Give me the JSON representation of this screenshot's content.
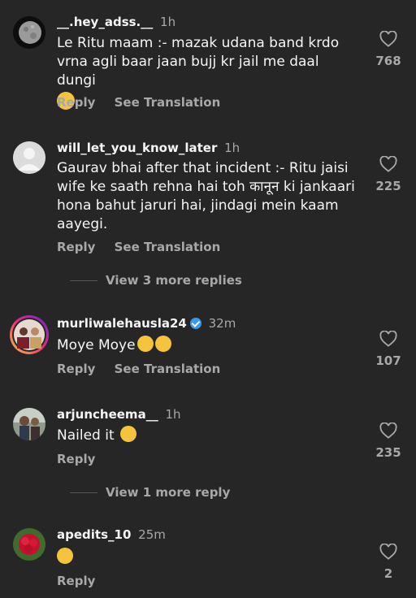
{
  "comments": [
    {
      "username": "__.hey_adss.__",
      "time": "1h",
      "text": "Le Ritu maam :- mazak udana band krdo vrna agli baar jaan bujj kr jail me daal dungi",
      "emojis": [
        "hugging-face"
      ],
      "likes": "768",
      "reply": "Reply",
      "translate": "See Translation",
      "avatar": "moon-avatar"
    },
    {
      "username": "will_let_you_know_later",
      "time": "1h",
      "text": "Gaurav bhai after that incident :- Ritu jaisi wife ke saath rehna hai toh कानून ki jankaari hona bahut jaruri hai, jindagi mein kaam aayegi.",
      "likes": "225",
      "reply": "Reply",
      "translate": "See Translation",
      "view_more": "View 3 more replies",
      "avatar": "default-avatar"
    },
    {
      "username": "murliwalehausla24",
      "verified": true,
      "time": "32m",
      "text": "Moye Moye",
      "emojis": [
        "tears-of-joy",
        "crying-face"
      ],
      "likes": "107",
      "reply": "Reply",
      "translate": "See Translation",
      "avatar": "story-ring-avatar"
    },
    {
      "username": "arjuncheema__",
      "time": "1h",
      "text": "Nailed it",
      "emojis": [
        "tears-of-joy"
      ],
      "likes": "235",
      "reply": "Reply",
      "view_more": "View 1 more reply",
      "avatar": "photo-avatar"
    },
    {
      "username": "apedits_10",
      "time": "25m",
      "text": "",
      "emojis": [
        "tears-of-joy"
      ],
      "likes": "2",
      "reply": "Reply",
      "avatar": "flower-avatar"
    }
  ],
  "colors": {
    "background": "#262626",
    "primary_text": "#f5f5f5",
    "secondary_text": "#a8a8a8",
    "verified": "#3897f0"
  }
}
